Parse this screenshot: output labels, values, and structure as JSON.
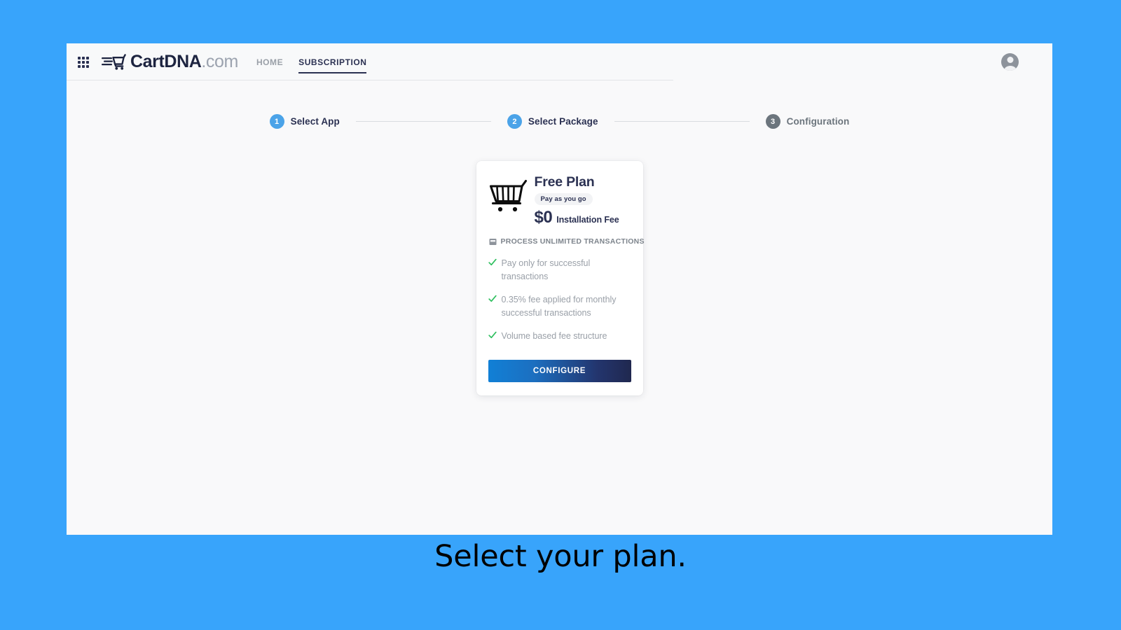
{
  "caption": "Select your plan.",
  "theme": {
    "page_background": "#38a4fb",
    "panel_background": "#f9f9fa",
    "accent_blue": "#4ba3e8",
    "navy": "#2b3152",
    "muted_gray": "#9aa0a8",
    "check_green": "#2fbf5f",
    "button_gradient_from": "#1180d6",
    "button_gradient_to": "#20284f"
  },
  "header": {
    "grid_icon": "apps-grid-icon",
    "brand_mark": "cart-logo-icon",
    "brand_name": "CartDNA",
    "brand_tld": ".com",
    "nav": [
      {
        "label": "HOME",
        "active": false
      },
      {
        "label": "SUBSCRIPTION",
        "active": true
      }
    ],
    "avatar_icon": "user-avatar-icon"
  },
  "stepper": {
    "steps": [
      {
        "number": "1",
        "label": "Select App",
        "state": "active"
      },
      {
        "number": "2",
        "label": "Select Package",
        "state": "active"
      },
      {
        "number": "3",
        "label": "Configuration",
        "state": "inactive"
      }
    ]
  },
  "plan_card": {
    "icon": "shopping-cart-icon",
    "title": "Free Plan",
    "badge": "Pay as you go",
    "price": "$0",
    "price_label": "Installation Fee",
    "subhead_icon": "transactions-icon",
    "subhead": "PROCESS UNLIMITED TRANSACTIONS",
    "features": [
      "Pay only for successful transactions",
      "0.35% fee applied for monthly successful transactions",
      "Volume based fee structure"
    ],
    "cta_label": "CONFIGURE"
  }
}
